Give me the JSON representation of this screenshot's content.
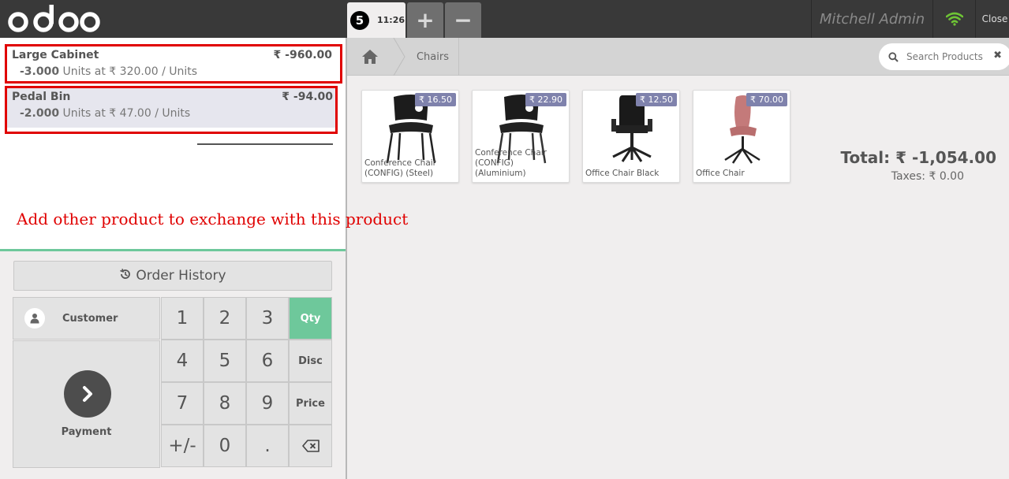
{
  "topbar": {
    "brand": "odoo",
    "order_number": "5",
    "order_time": "11:26",
    "add_order": "+",
    "remove_order": "−",
    "user": "Mitchell Admin",
    "close": "Close"
  },
  "orderlines": [
    {
      "name": "Large Cabinet",
      "price": "₹ -960.00",
      "qty": "-3.000",
      "detail": " Units at ₹ 320.00 / Units"
    },
    {
      "name": "Pedal Bin",
      "price": "₹ -94.00",
      "qty": "-2.000",
      "detail": " Units at ₹ 47.00 / Units"
    }
  ],
  "summary": {
    "total": "Total: ₹ -1,054.00",
    "taxes": "Taxes: ₹ 0.00"
  },
  "annotation": "Add other product to exchange with this product",
  "controls": {
    "order_history": "Order History",
    "customer": "Customer",
    "payment": "Payment"
  },
  "numpad": {
    "keys": [
      "1",
      "2",
      "3",
      "Qty",
      "4",
      "5",
      "6",
      "Disc",
      "7",
      "8",
      "9",
      "Price",
      "+/-",
      "0",
      ".",
      "⌫"
    ],
    "active_mode": "Qty"
  },
  "breadcrumb": {
    "category": "Chairs"
  },
  "search": {
    "placeholder": "Search Products"
  },
  "products": [
    {
      "name": "Conference Chair (CONFIG) (Steel)",
      "price": "₹ 16.50",
      "icon": "chair-steel-icon"
    },
    {
      "name": "Conference Chair (CONFIG) (Aluminium)",
      "price": "₹ 22.90",
      "icon": "chair-aluminium-icon"
    },
    {
      "name": "Office Chair Black",
      "price": "₹ 12.50",
      "icon": "office-chair-black-icon"
    },
    {
      "name": "Office Chair",
      "price": "₹ 70.00",
      "icon": "office-chair-pink-icon"
    }
  ],
  "colors": {
    "topbar": "#393939",
    "accent": "#6ec89b",
    "price_tag": "#7f82ac",
    "highlight": "#e00000",
    "wifi": "#6ec335"
  }
}
